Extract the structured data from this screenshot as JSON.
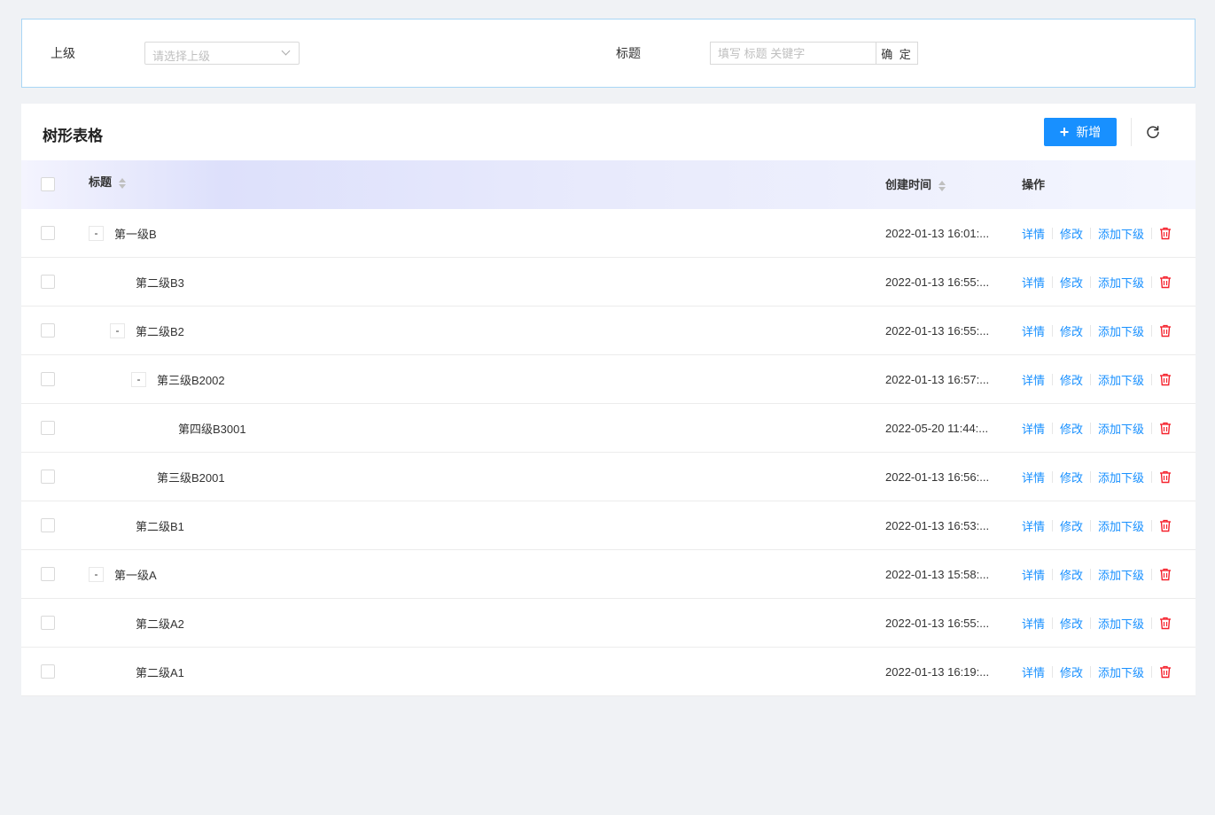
{
  "filters": {
    "parent_label": "上级",
    "parent_placeholder": "请选择上级",
    "title_label": "标题",
    "title_placeholder": "填写 标题 关键字",
    "confirm_label": "确 定"
  },
  "card": {
    "title": "树形表格",
    "add_label": "新增"
  },
  "table": {
    "columns": {
      "title": "标题",
      "created": "创建时间",
      "actions": "操作"
    },
    "action_labels": {
      "detail": "详情",
      "edit": "修改",
      "add_child": "添加下级"
    },
    "rows": [
      {
        "title": "第一级B",
        "created": "2022-01-13 16:01:...",
        "level": 0,
        "expander": "-"
      },
      {
        "title": "第二级B3",
        "created": "2022-01-13 16:55:...",
        "level": 1,
        "expander": ""
      },
      {
        "title": "第二级B2",
        "created": "2022-01-13 16:55:...",
        "level": 1,
        "expander": "-"
      },
      {
        "title": "第三级B2002",
        "created": "2022-01-13 16:57:...",
        "level": 2,
        "expander": "-"
      },
      {
        "title": "第四级B3001",
        "created": "2022-05-20 11:44:...",
        "level": 3,
        "expander": ""
      },
      {
        "title": "第三级B2001",
        "created": "2022-01-13 16:56:...",
        "level": 2,
        "expander": ""
      },
      {
        "title": "第二级B1",
        "created": "2022-01-13 16:53:...",
        "level": 1,
        "expander": ""
      },
      {
        "title": "第一级A",
        "created": "2022-01-13 15:58:...",
        "level": 0,
        "expander": "-"
      },
      {
        "title": "第二级A2",
        "created": "2022-01-13 16:55:...",
        "level": 1,
        "expander": ""
      },
      {
        "title": "第二级A1",
        "created": "2022-01-13 16:19:...",
        "level": 1,
        "expander": ""
      }
    ]
  },
  "colors": {
    "primary": "#1890ff",
    "danger": "#f5222d"
  },
  "icons": {
    "add": "plus-icon",
    "refresh": "refresh-icon",
    "delete": "trash-icon",
    "dropdown": "chevron-down-icon",
    "sort": "sort-icon"
  }
}
